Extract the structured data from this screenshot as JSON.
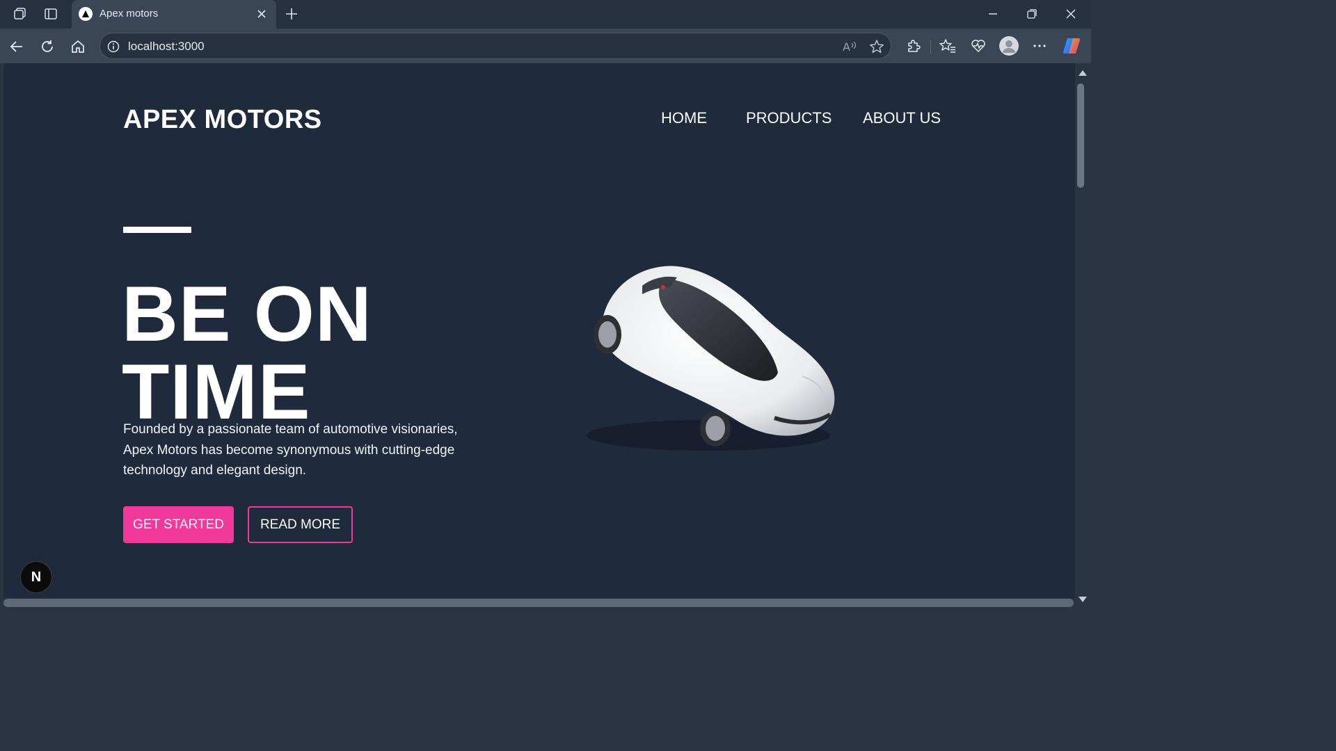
{
  "browser": {
    "tab_title": "Apex motors",
    "address": "localhost:3000"
  },
  "page": {
    "logo": "APEX MOTORS",
    "nav": [
      "HOME",
      "PRODUCTS",
      "ABOUT US"
    ],
    "hero_line1": "BE ON",
    "hero_line2": "TIME",
    "description": "Founded by a passionate team of automotive visionaries, Apex Motors has become synonymous with cutting-edge technology and elegant design.",
    "primary_button": "GET STARTED",
    "secondary_button": "READ MORE",
    "badge": "N",
    "accent_color": "#f0399a",
    "background_color": "#1f2a3c"
  },
  "icons": [
    "workspaces-icon",
    "tab-actions-icon",
    "nextjs-favicon-icon",
    "close-tab-icon",
    "new-tab-icon",
    "minimize-icon",
    "restore-icon",
    "close-window-icon",
    "back-icon",
    "refresh-icon",
    "home-icon",
    "site-info-icon",
    "read-aloud-icon",
    "favorite-star-icon",
    "extensions-icon",
    "favorites-icon",
    "browser-essentials-icon",
    "profile-avatar-icon",
    "more-icon",
    "copilot-icon",
    "car-image"
  ]
}
